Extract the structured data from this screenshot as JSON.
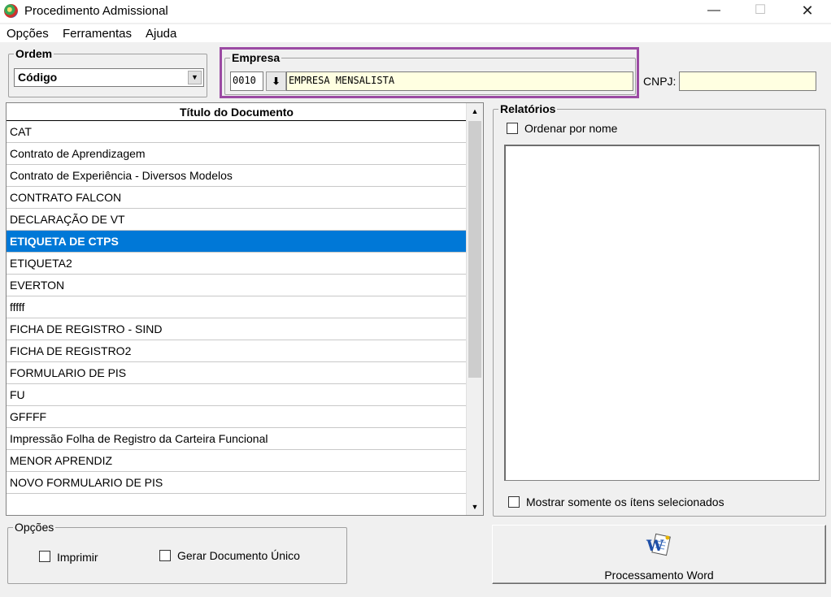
{
  "window": {
    "title": "Procedimento Admissional",
    "minimize": "—",
    "maximize": "☐",
    "close": "✕"
  },
  "menu": {
    "items": [
      "Opções",
      "Ferramentas",
      "Ajuda"
    ]
  },
  "ordem": {
    "legend": "Ordem",
    "selected": "Código"
  },
  "empresa": {
    "legend": "Empresa",
    "code": "0010",
    "name": "EMPRESA MENSALISTA",
    "cnpj_label": "CNPJ:",
    "cnpj_value": ""
  },
  "documents": {
    "header": "Título do Documento",
    "items": [
      "CAT",
      "Contrato de Aprendizagem",
      "Contrato de Experiência - Diversos Modelos",
      "CONTRATO FALCON",
      "DECLARAÇÃO DE VT",
      "ETIQUETA DE CTPS",
      "ETIQUETA2",
      "EVERTON",
      "fffff",
      "FICHA DE REGISTRO - SIND",
      "FICHA DE REGISTRO2",
      "FORMULARIO DE PIS",
      "FU",
      "GFFFF",
      "Impressão Folha de Registro da Carteira Funcional",
      "MENOR APRENDIZ",
      "NOVO FORMULARIO DE PIS",
      ""
    ],
    "selected_index": 5
  },
  "relatorios": {
    "legend": "Relatórios",
    "sort_by_name": "Ordenar por nome",
    "show_selected_only": "Mostrar somente os ítens selecionados"
  },
  "opcoes": {
    "legend": "Opções",
    "print": "Imprimir",
    "single_doc": "Gerar Documento Único"
  },
  "actions": {
    "word_label": "Processamento Word"
  },
  "colors": {
    "selection": "#0078d7",
    "highlight_box": "#9b4aa3",
    "field_yellow": "#ffffe1"
  }
}
